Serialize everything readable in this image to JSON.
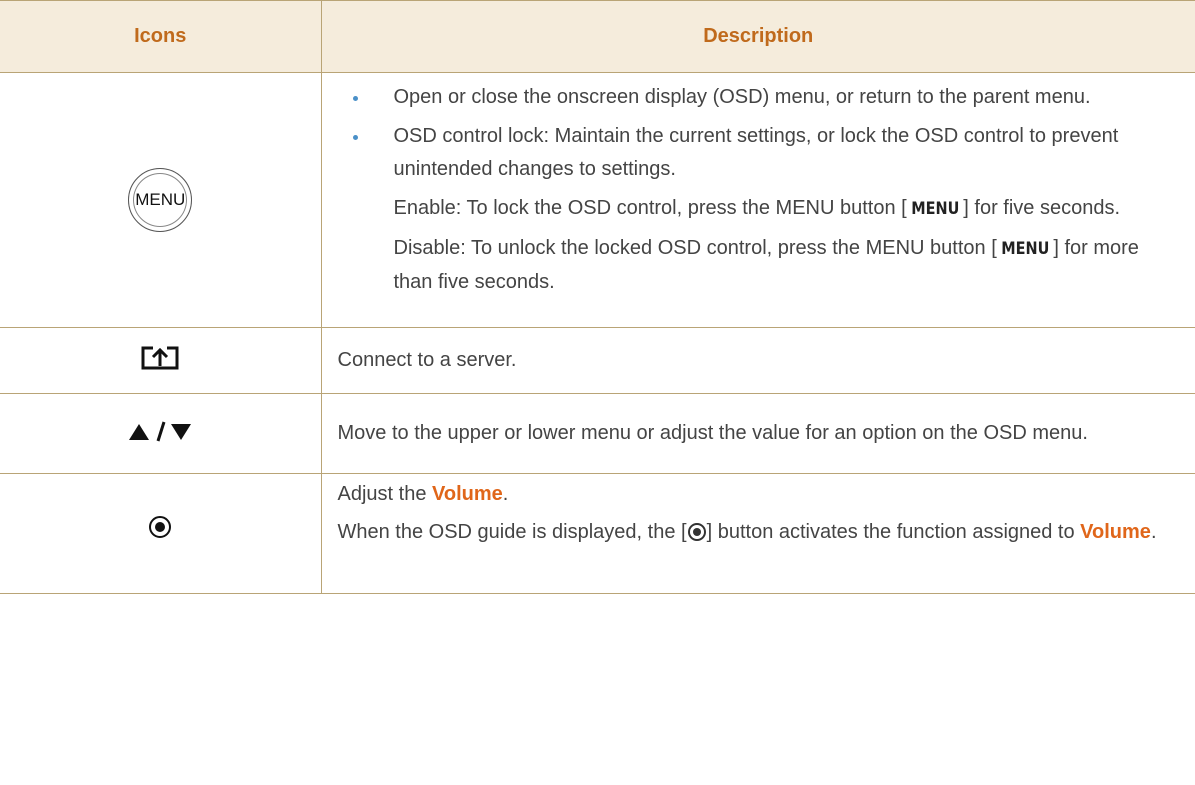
{
  "table": {
    "headers": {
      "icons": "Icons",
      "description": "Description"
    },
    "rows": {
      "menu": {
        "icon_label": "MENU",
        "icon_name": "menu-button-icon",
        "bullets": [
          "Open or close the onscreen display (OSD) menu, or return to the parent menu.",
          "OSD control lock: Maintain the current settings, or lock the OSD control to prevent unintended changes to settings."
        ],
        "enable": {
          "before": "Enable: To lock the OSD control, press the MENU button [",
          "key": "MENU",
          "after": "] for five seconds."
        },
        "disable": {
          "before": "Disable: To unlock the locked OSD control, press the MENU button [",
          "key": "MENU",
          "after": "] for more than five seconds."
        }
      },
      "source": {
        "icon_name": "source-input-icon",
        "text": "Connect to a server."
      },
      "updown": {
        "icon_name": "up-down-arrows-icon",
        "text": "Move to the upper or lower menu or adjust the value for an option on the OSD menu."
      },
      "volume": {
        "icon_name": "round-button-icon",
        "line1_before": "Adjust the ",
        "line1_highlight": "Volume",
        "line1_after": ".",
        "line2_before": "When the OSD guide is displayed, the [",
        "line2_after": "] button activates the function assigned to ",
        "line2_highlight": "Volume",
        "line2_end": "."
      }
    }
  },
  "colors": {
    "header_bg": "#f5ecdc",
    "header_text": "#c06a1c",
    "border": "#b9a476",
    "highlight": "#e0661a",
    "bullet": "#4a90c8",
    "body_text": "#444444"
  }
}
